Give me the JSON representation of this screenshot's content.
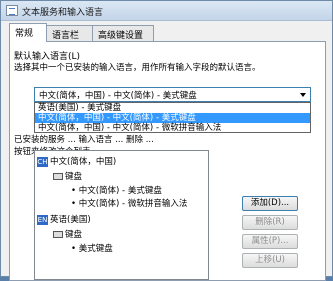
{
  "window": {
    "title": "文本服务和输入语言"
  },
  "tabs": [
    {
      "label": "常规",
      "active": true
    },
    {
      "label": "语言栏",
      "active": false
    },
    {
      "label": "高级键设置",
      "active": false
    }
  ],
  "default_language": {
    "heading": "默认输入语言(L)",
    "description": "选择其中一个已安装的输入语言，用作所有输入字段的默认语言。",
    "selected_value": "中文(简体，中国) - 中文(简体) - 美式键盘",
    "options": [
      "英语(美国) - 美式键盘",
      "中文(简体，中国) - 中文(简体) - 美式键盘",
      "中文(简体，中国) - 中文(简体) - 微软拼音输入法"
    ],
    "selected_index": 1
  },
  "partial_text": {
    "line1": "已安装的服务 ... 输入语言 ... 删除 ...",
    "line2": "按钮来修改这个列表。"
  },
  "tree": [
    {
      "badge": "CH",
      "label": "中文(简体，中国)"
    },
    {
      "label": "键盘"
    },
    {
      "label": "• 中文(简体) - 美式键盘"
    },
    {
      "label": "• 中文(简体) - 微软拼音输入法"
    },
    {
      "badge": "EN",
      "label": "英语(美国)"
    },
    {
      "label": "键盘"
    },
    {
      "label": "• 美式键盘"
    }
  ],
  "buttons": {
    "add": "添加(D)...",
    "remove": "删除(R)",
    "properties": "属性(P)...",
    "move_up": "上移(U)"
  }
}
